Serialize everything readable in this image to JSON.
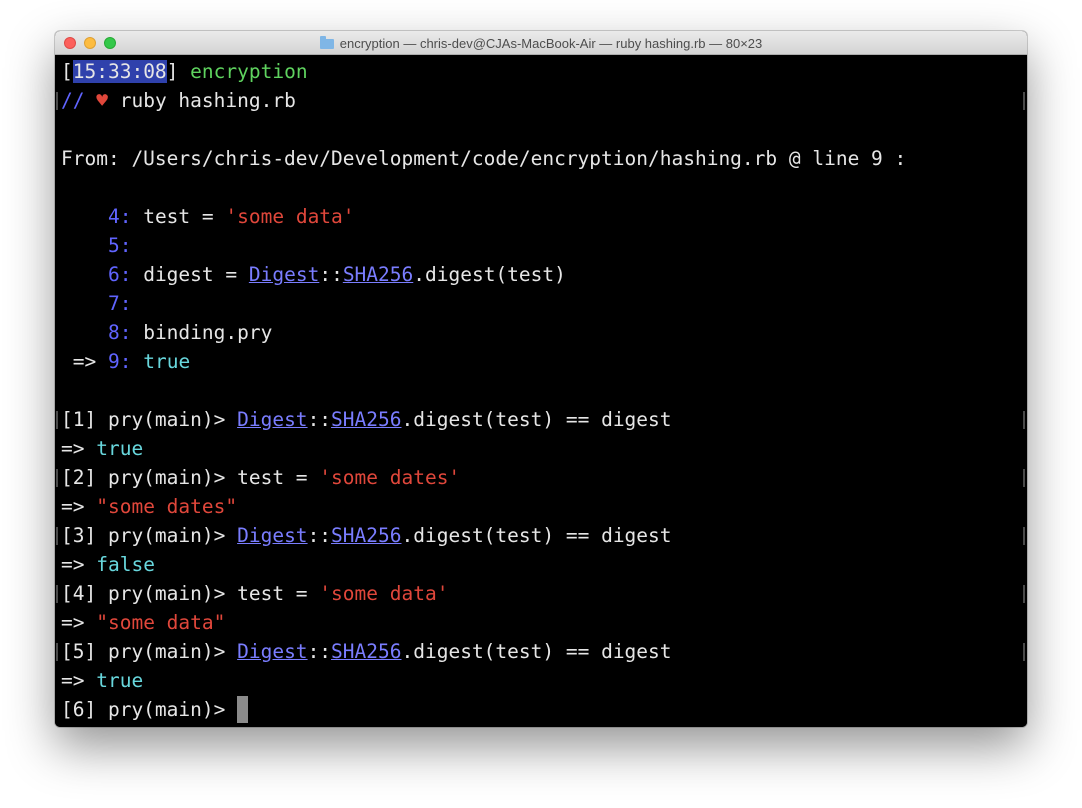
{
  "window": {
    "title": "encryption — chris-dev@CJAs-MacBook-Air — ruby hashing.rb — 80×23"
  },
  "colors": {
    "prompt_dir": "#5fd35f",
    "string": "#e0473b",
    "boolean": "#68d7dd",
    "line_number": "#6064ff",
    "constant_link": "#7a7dff",
    "selection": "#2f41ac",
    "background": "#000000",
    "foreground": "#e6e6e6"
  },
  "terminal": {
    "prompt": {
      "bracket_open": "[",
      "time": "15:33:08",
      "bracket_close": "]",
      "directory": "encryption",
      "slashes": "//",
      "heart": "♥",
      "command": "ruby hashing.rb"
    },
    "from_line": "From: /Users/chris-dev/Development/code/encryption/hashing.rb @ line 9 :",
    "source": [
      {
        "num": "4:",
        "pre": "test = ",
        "str": "'some data'"
      },
      {
        "num": "5:"
      },
      {
        "num": "6:",
        "pre": "digest = ",
        "c1": "Digest",
        "sep": "::",
        "c2": "SHA256",
        "post": ".digest(test)"
      },
      {
        "num": "7:"
      },
      {
        "num": "8:",
        "pre": "binding.pry"
      },
      {
        "arrow": "=>",
        "num": "9:",
        "kw": "true"
      }
    ],
    "session": [
      {
        "prompt": "[1] pry(main)> ",
        "c1": "Digest",
        "sep": "::",
        "c2": "SHA256",
        "rest": ".digest(test) == digest",
        "result_arrow": "=> ",
        "result": "true"
      },
      {
        "prompt": "[2] pry(main)> ",
        "pre": "test = ",
        "str": "'some dates'",
        "result_arrow": "=> ",
        "result": "\"some dates\""
      },
      {
        "prompt": "[3] pry(main)> ",
        "c1": "Digest",
        "sep": "::",
        "c2": "SHA256",
        "rest": ".digest(test) == digest",
        "result_arrow": "=> ",
        "result": "false"
      },
      {
        "prompt": "[4] pry(main)> ",
        "pre": "test = ",
        "str": "'some data'",
        "result_arrow": "=> ",
        "result": "\"some data\""
      },
      {
        "prompt": "[5] pry(main)> ",
        "c1": "Digest",
        "sep": "::",
        "c2": "SHA256",
        "rest": ".digest(test) == digest",
        "result_arrow": "=> ",
        "result": "true"
      }
    ],
    "current_prompt": "[6] pry(main)> "
  }
}
